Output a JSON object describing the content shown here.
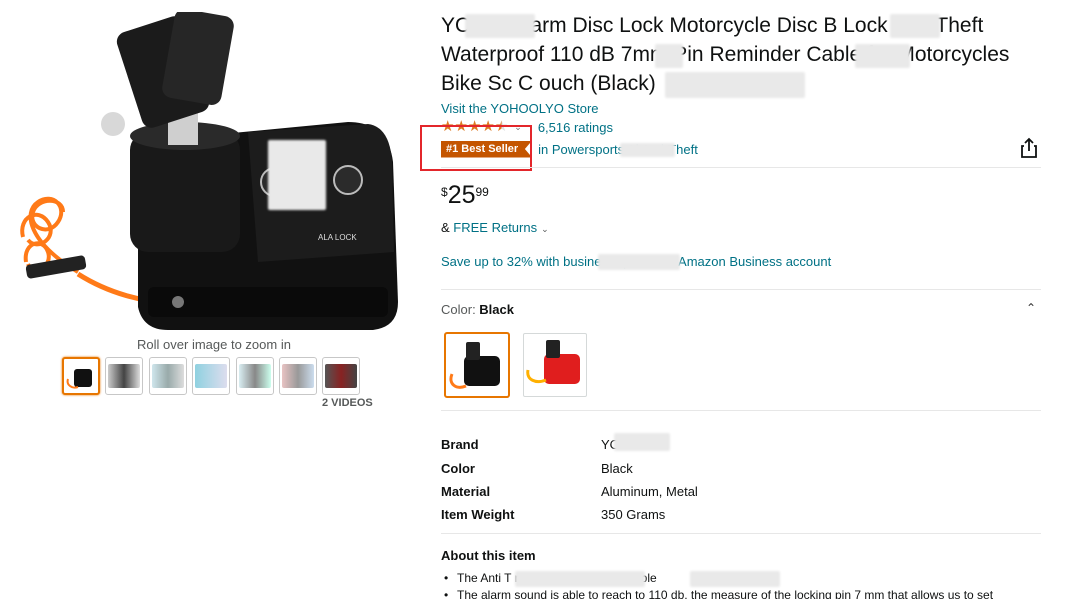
{
  "product": {
    "title": "YO    YO Alarm Disc Lock Motorcycle Disc B    Lock Anti-Theft Waterproof 110 dB 7mm Pin     Reminder Cable for Motorcycles Bike Sc      C      ouch (Black)",
    "store_link": "Visit the YOHOOLYO Store",
    "rating": {
      "stars": 4.5,
      "count_label": "6,516 ratings"
    },
    "badge": {
      "label": "#1 Best Seller",
      "category": "in Powersports Al        Anti-Theft"
    },
    "price": {
      "symbol": "$",
      "whole": "25",
      "fraction": "99"
    },
    "returns": {
      "prefix": "& ",
      "link": "FREE Returns"
    },
    "business_offer": "Save up to 32% with busine              n up for free Amazon Business account",
    "color": {
      "label": "Color: ",
      "value": "Black"
    },
    "specs": [
      {
        "key": "Brand",
        "value": "YO"
      },
      {
        "key": "Color",
        "value": "Black"
      },
      {
        "key": "Material",
        "value": "Aluminum, Metal"
      },
      {
        "key": "Item Weight",
        "value": "350 Grams"
      }
    ],
    "about": {
      "title": "About this item",
      "bullets": [
        "The Anti T                           rely of n               ureky and durable",
        "The alarm sound is able to reach to 110 db, the measure of the locking pin 7 mm that allows us to set"
      ]
    }
  },
  "gallery": {
    "zoom_hint": "Roll over image to zoom in",
    "videos_label": "2 VIDEOS",
    "thumbnail_count": 7
  },
  "colors": {
    "star": "#de7921",
    "link": "#007185",
    "badge": "#c45500",
    "highlight_box": "#e3262b",
    "selected_border": "#e77600"
  }
}
